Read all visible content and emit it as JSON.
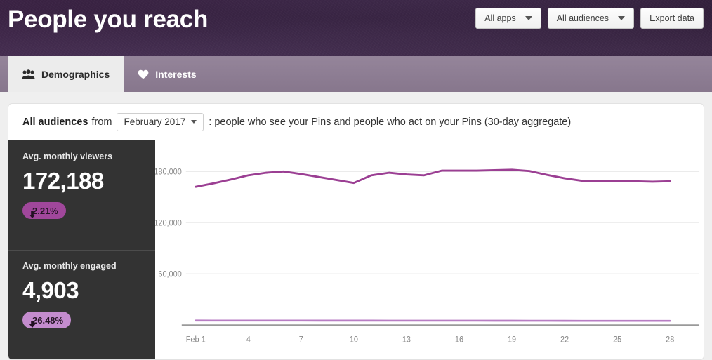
{
  "header": {
    "title": "People you reach",
    "buttons": [
      {
        "label": "All apps",
        "has_caret": true,
        "icon": "chevron-down-icon"
      },
      {
        "label": "All audiences",
        "has_caret": true,
        "icon": "chevron-down-icon"
      },
      {
        "label": "Export data",
        "has_caret": false,
        "icon": null
      }
    ]
  },
  "tabs": [
    {
      "label": "Demographics",
      "icon": "people-group-icon",
      "active": true
    },
    {
      "label": "Interests",
      "icon": "heart-icon",
      "active": false
    }
  ],
  "filter": {
    "audience_label": "All audiences",
    "from_word": "from",
    "month": "February 2017",
    "month_caret": "chevron-down-icon",
    "description": ": people who see your Pins and people who act on your Pins (30-day aggregate)"
  },
  "metrics": [
    {
      "label": "Avg. monthly viewers",
      "value": "172,188",
      "change": "2.21%",
      "direction": "down",
      "badge_color": "#a0479b",
      "badge_text_color": "#241424"
    },
    {
      "label": "Avg. monthly engaged",
      "value": "4,903",
      "change": "26.48%",
      "direction": "down",
      "badge_color": "#c48cce",
      "badge_text_color": "#241424"
    }
  ],
  "colors": {
    "header_bg": "#33203d",
    "tabbar_bg": "#8e7d94",
    "metrics_bg": "#333333",
    "viewers_line": "#9b3f93",
    "engaged_line": "#b87ec4",
    "gridline": "#e8e8e8",
    "axis": "#9a9a9a"
  },
  "chart_data": {
    "type": "line",
    "title": "",
    "xlabel": "",
    "ylabel": "",
    "grid": true,
    "legend": "none",
    "xlim": [
      1,
      28
    ],
    "ylim": [
      0,
      200000
    ],
    "yticks": [
      60000,
      120000,
      180000
    ],
    "ytick_labels": [
      "60,000",
      "120,000",
      "180,000"
    ],
    "xticks": [
      1,
      4,
      7,
      10,
      13,
      16,
      19,
      22,
      25,
      28
    ],
    "xtick_labels": [
      "Feb 1",
      "4",
      "7",
      "10",
      "13",
      "16",
      "19",
      "22",
      "25",
      "28"
    ],
    "x": [
      1,
      2,
      3,
      4,
      5,
      6,
      7,
      8,
      9,
      10,
      11,
      12,
      13,
      14,
      15,
      16,
      17,
      18,
      19,
      20,
      21,
      22,
      23,
      24,
      25,
      26,
      27,
      28
    ],
    "series": [
      {
        "name": "Avg. monthly viewers",
        "color": "#9b3f93",
        "values": [
          162000,
          166000,
          170500,
          175500,
          178500,
          180000,
          177000,
          173500,
          170000,
          166500,
          175500,
          178500,
          176500,
          175500,
          181000,
          181000,
          181000,
          181500,
          182000,
          180500,
          176000,
          172000,
          169000,
          168500,
          168500,
          168500,
          168000,
          168500
        ]
      },
      {
        "name": "Avg. monthly engaged",
        "color": "#b87ec4",
        "values": [
          5250,
          5240,
          5230,
          5215,
          5200,
          5190,
          5180,
          5170,
          5160,
          5150,
          5140,
          5130,
          5120,
          5110,
          5100,
          5090,
          5080,
          5060,
          5040,
          5010,
          4980,
          4950,
          4930,
          4915,
          4905,
          4900,
          4900,
          4903
        ]
      }
    ]
  }
}
